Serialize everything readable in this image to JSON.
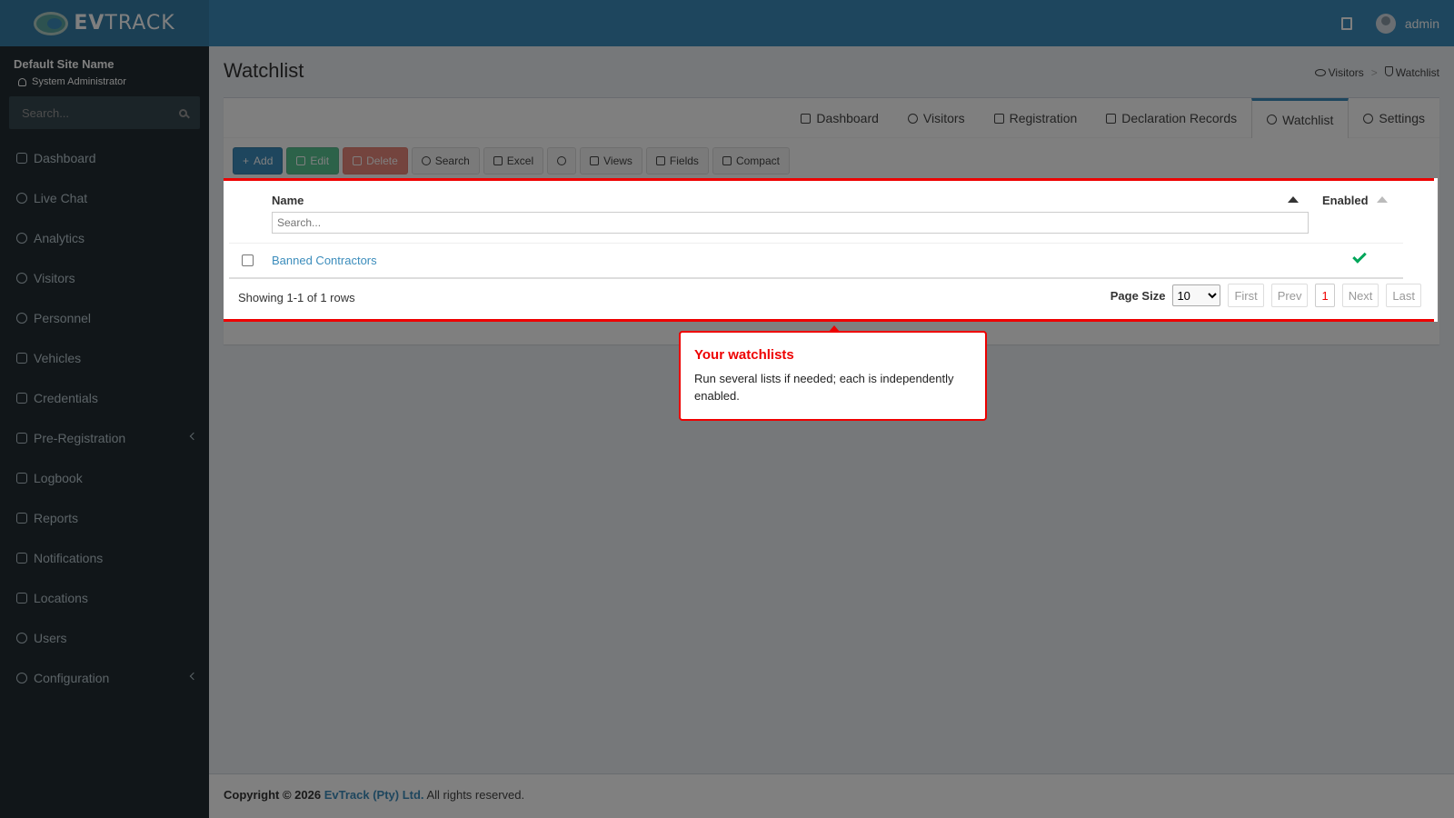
{
  "header": {
    "brand_bold": "EV",
    "brand_rest": "TRACK",
    "username": "admin"
  },
  "sidebar": {
    "site_name": "Default Site Name",
    "role": "System Administrator",
    "search_placeholder": "Search...",
    "items": [
      {
        "label": "Dashboard",
        "icon": "dashboard-icon"
      },
      {
        "label": "Live Chat",
        "icon": "headset-icon"
      },
      {
        "label": "Analytics",
        "icon": "target-icon"
      },
      {
        "label": "Visitors",
        "icon": "eye-icon"
      },
      {
        "label": "Personnel",
        "icon": "users-icon"
      },
      {
        "label": "Vehicles",
        "icon": "car-icon"
      },
      {
        "label": "Credentials",
        "icon": "id-card-icon"
      },
      {
        "label": "Pre-Registration",
        "icon": "exchange-icon"
      },
      {
        "label": "Logbook",
        "icon": "book-icon"
      },
      {
        "label": "Reports",
        "icon": "chart-icon"
      },
      {
        "label": "Notifications",
        "icon": "comments-icon"
      },
      {
        "label": "Locations",
        "icon": "map-icon"
      },
      {
        "label": "Users",
        "icon": "user-cog-icon"
      },
      {
        "label": "Configuration",
        "icon": "gear-icon"
      }
    ]
  },
  "page": {
    "title": "Watchlist",
    "breadcrumb": [
      "Visitors",
      "Watchlist"
    ]
  },
  "tabs": [
    "Dashboard",
    "Visitors",
    "Registration",
    "Declaration Records",
    "Watchlist",
    "Settings"
  ],
  "active_tab": "Watchlist",
  "toolbar": {
    "add": "Add",
    "edit": "Edit",
    "delete": "Delete",
    "search": "Search",
    "excel": "Excel",
    "views": "Views",
    "fields": "Fields",
    "compact": "Compact"
  },
  "grid": {
    "columns": [
      "Name",
      "Enabled"
    ],
    "search_placeholder": "Search...",
    "rows": [
      {
        "name": "Banned Contractors",
        "enabled": true
      }
    ],
    "info": "Showing 1-1 of 1 rows",
    "page_size_label": "Page Size",
    "page_size": "10",
    "pager": {
      "first": "First",
      "prev": "Prev",
      "current": "1",
      "next": "Next",
      "last": "Last"
    }
  },
  "tooltip": {
    "title": "Your watchlists",
    "body": "Run several lists if needed; each is independently enabled."
  },
  "footer": {
    "prefix": "Copyright © 2026",
    "company": "EvTrack (Pty) Ltd.",
    "suffix": "All rights reserved."
  }
}
